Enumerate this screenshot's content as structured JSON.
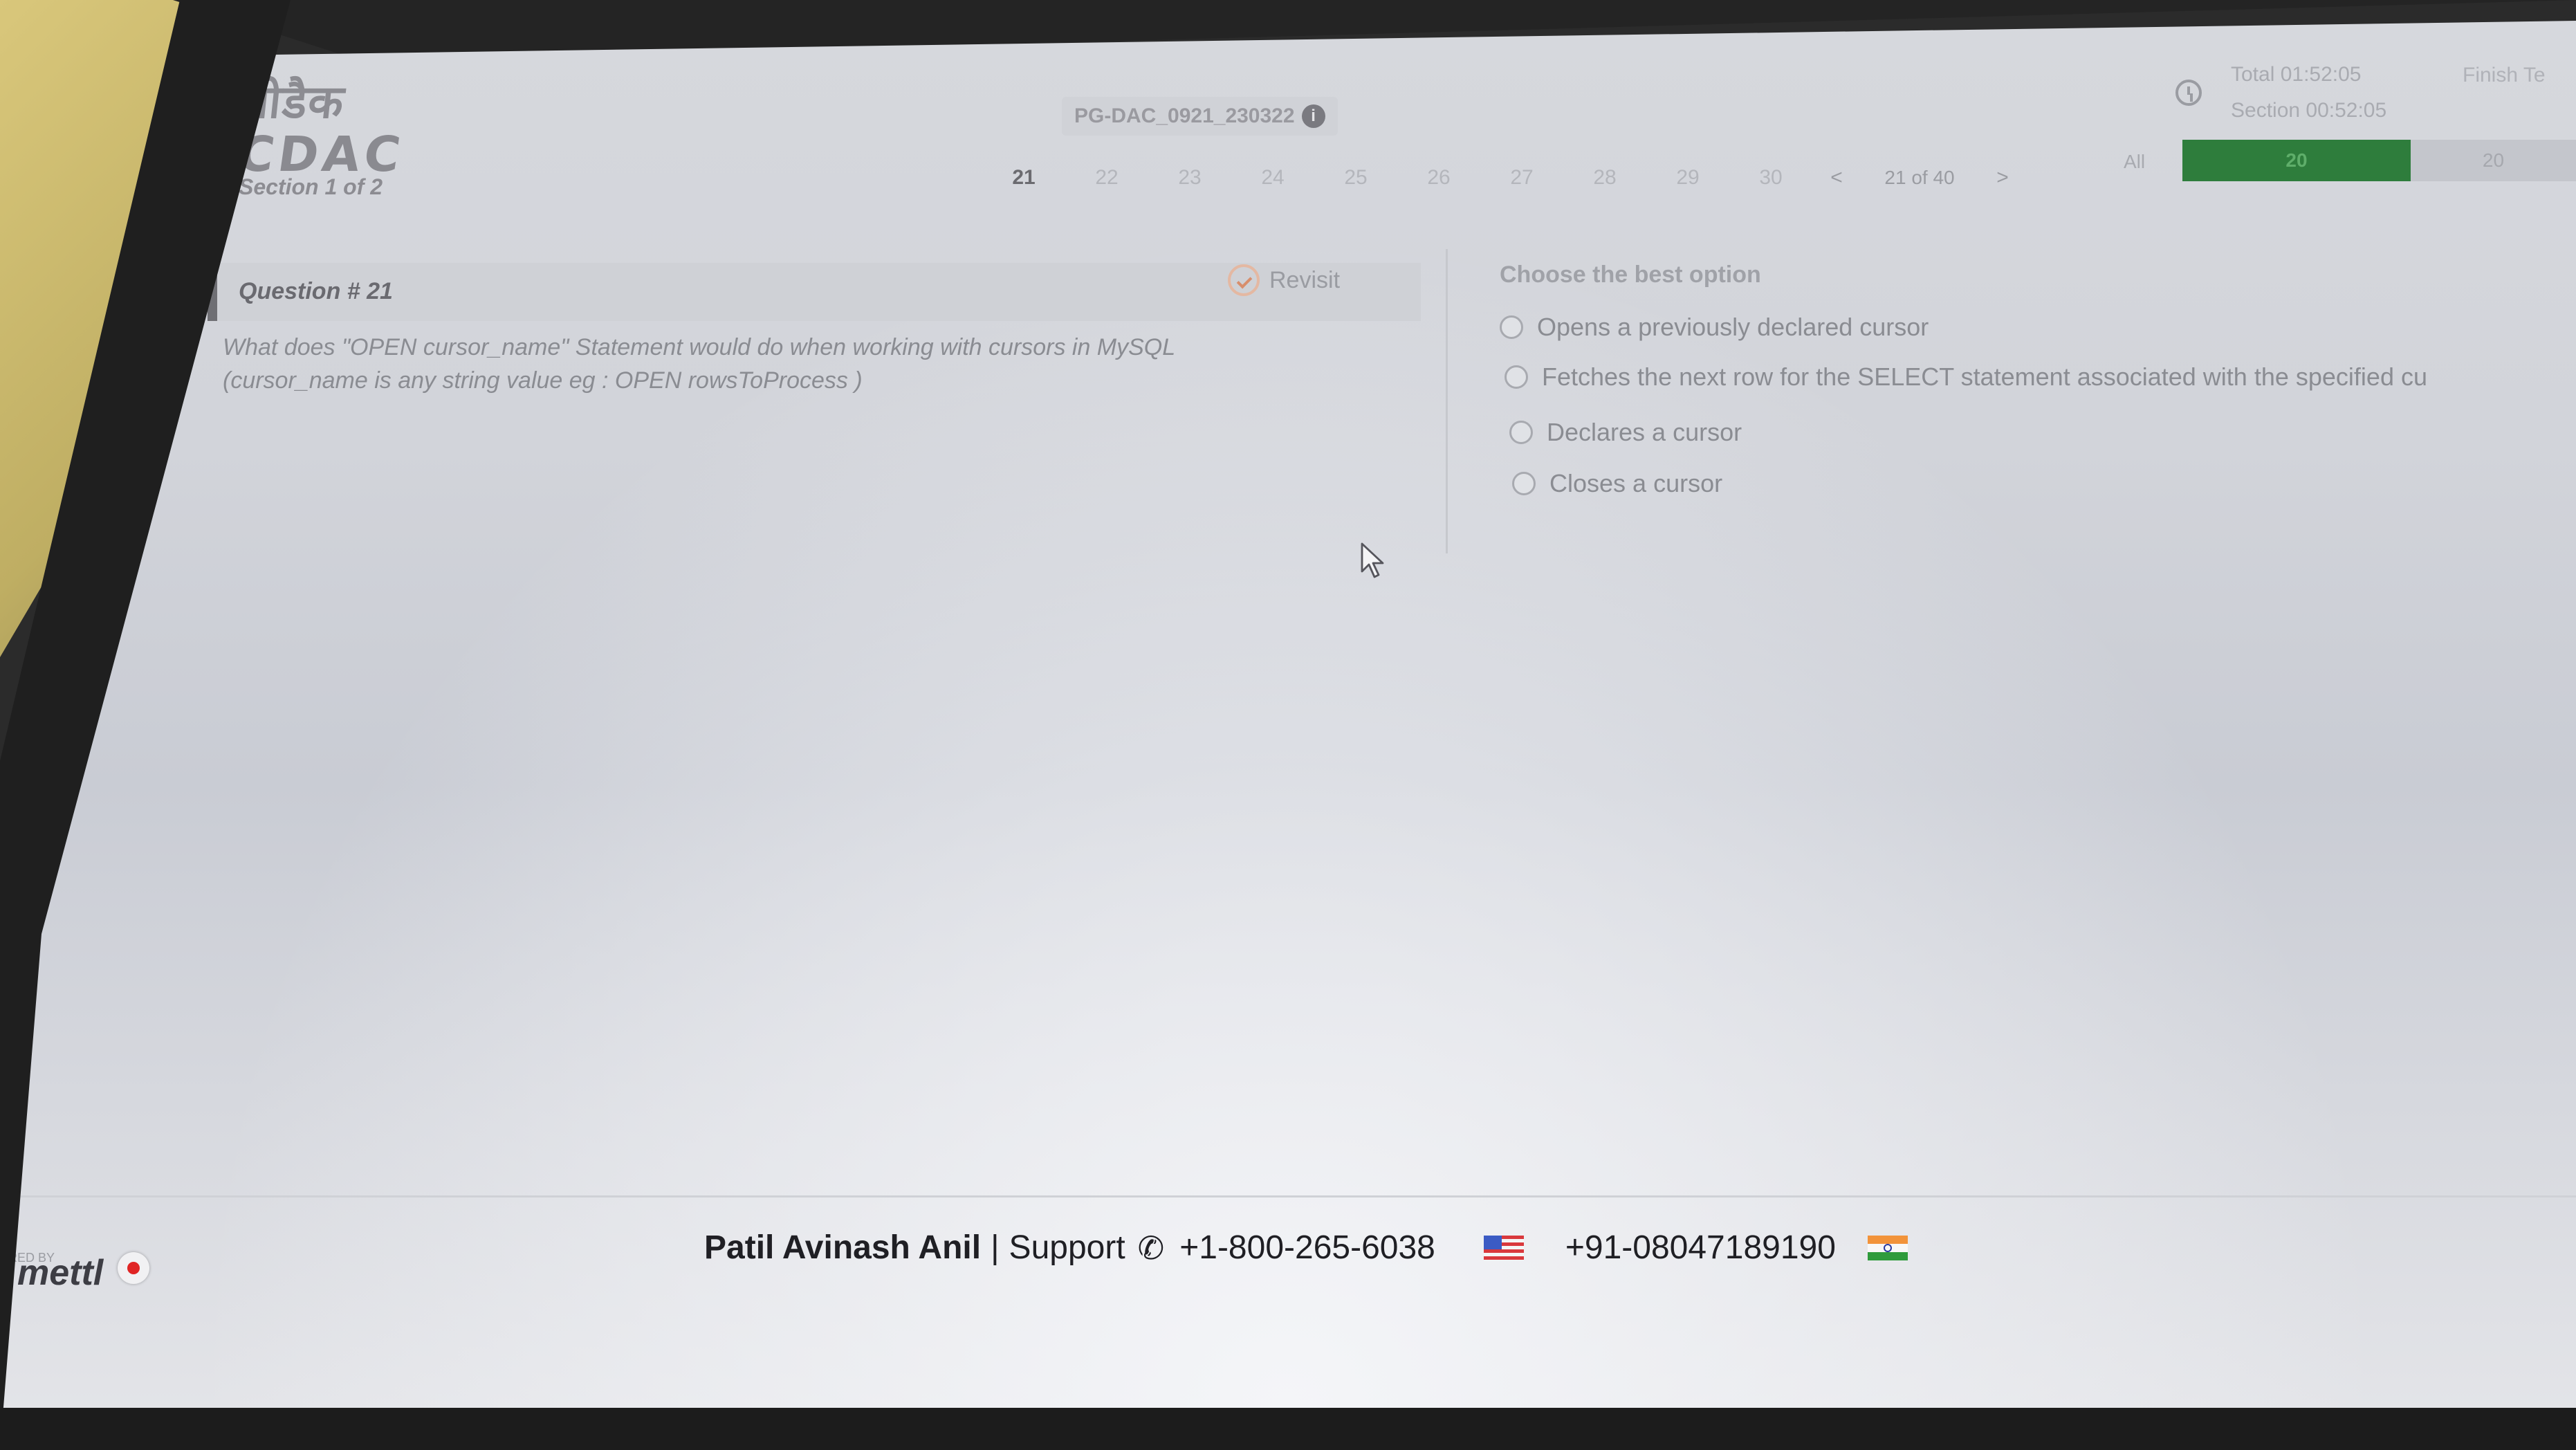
{
  "header": {
    "brand_hindi": "सीडैक",
    "brand_latin": "CDAC",
    "section_label": "Section 1 of 2",
    "exam_code": "PG-DAC_0921_230322",
    "question_nav": {
      "numbers": [
        "21",
        "22",
        "23",
        "24",
        "25",
        "26",
        "27",
        "28",
        "29",
        "30"
      ],
      "active": "21",
      "prev_label": "<",
      "next_label": ">",
      "position_label": "21 of 40"
    },
    "timer_total": "Total 01:52:05",
    "timer_section": "Section 00:52:05",
    "finish_label": "Finish Te",
    "filter_all_label": "All",
    "progress_answered": "20",
    "progress_remaining": "20",
    "colors": {
      "progress_green": "#2e7d3c"
    }
  },
  "question": {
    "title": "Question # 21",
    "revisit_label": "Revisit",
    "text_line1": "What does \"OPEN cursor_name\" Statement would do when working with cursors in MySQL",
    "text_line2": "(cursor_name is any string value eg : OPEN rowsToProcess )"
  },
  "options": {
    "title": "Choose the best option",
    "items": [
      "Opens a previously declared cursor",
      "Fetches the next row for the SELECT statement associated with the specified cu",
      "Declares a cursor",
      "Closes a cursor"
    ]
  },
  "footer": {
    "powered_by": "ERED BY",
    "logo_text": "mettl",
    "candidate_name": "Patil Avinash Anil",
    "separator": "|",
    "support_label": "Support",
    "phone_us": "+1-800-265-6038",
    "phone_in": "+91-08047189190"
  }
}
